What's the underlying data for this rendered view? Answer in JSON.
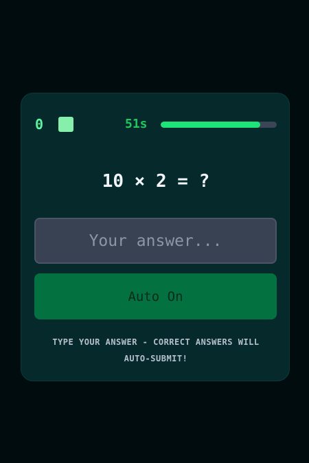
{
  "header": {
    "score": "0",
    "timer": "51s",
    "time_progress_percent": 86
  },
  "quiz": {
    "question": "10 × 2 = ?",
    "answer_value": "",
    "answer_placeholder": "Your answer...",
    "auto_button_label": "Auto On",
    "hint": "Type your answer - correct answers will auto-submit!"
  },
  "colors": {
    "background": "#010c0e",
    "card": "#062a2c",
    "accent": "#22c55e",
    "progress_fill": "#1ee378",
    "button": "#047141"
  },
  "icons": {
    "score_marker": "square-indicator-icon"
  }
}
